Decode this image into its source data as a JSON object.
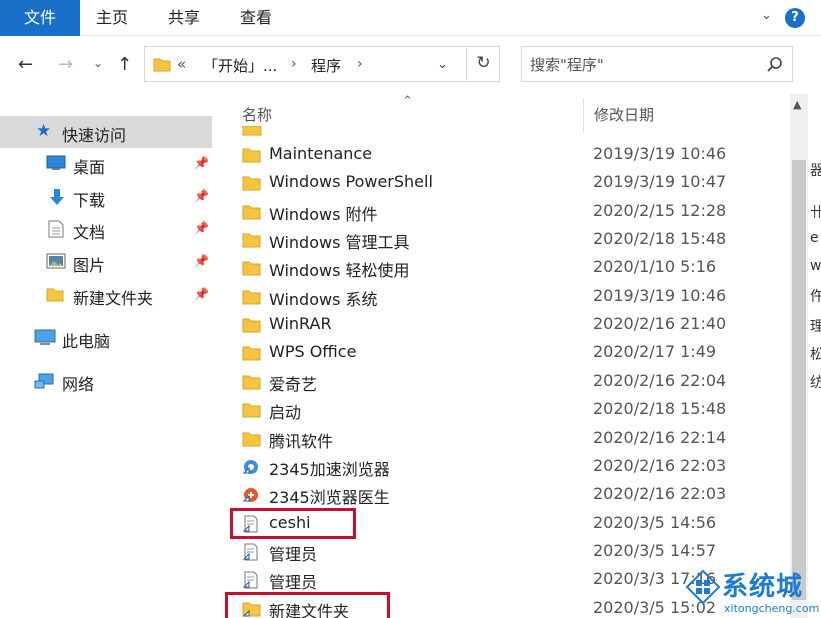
{
  "ribbon": {
    "tabs": [
      "文件",
      "主页",
      "共享",
      "查看"
    ],
    "help_label": "?"
  },
  "address": {
    "segments": [
      "«",
      "「开始」...",
      "程序"
    ],
    "search_placeholder": "搜索\"程序\""
  },
  "nav_pane": {
    "quick_access": "快速访问",
    "pinned": [
      "桌面",
      "下载",
      "文档",
      "图片",
      "新建文件夹"
    ],
    "this_pc": "此电脑",
    "network": "网络"
  },
  "file_list": {
    "columns": {
      "name": "名称",
      "modified": "修改日期"
    },
    "rows": [
      {
        "name": "Maintenance",
        "date": "2019/3/19 10:46",
        "icon": "folder-icon"
      },
      {
        "name": "Windows PowerShell",
        "date": "2019/3/19 10:47",
        "icon": "folder-icon"
      },
      {
        "name": "Windows 附件",
        "date": "2020/2/15 12:28",
        "icon": "folder-icon"
      },
      {
        "name": "Windows 管理工具",
        "date": "2020/2/18 15:48",
        "icon": "folder-icon"
      },
      {
        "name": "Windows 轻松使用",
        "date": "2020/1/10 5:16",
        "icon": "folder-icon"
      },
      {
        "name": "Windows 系统",
        "date": "2019/3/19 10:46",
        "icon": "folder-icon"
      },
      {
        "name": "WinRAR",
        "date": "2020/2/16 21:40",
        "icon": "folder-icon"
      },
      {
        "name": "WPS Office",
        "date": "2020/2/17 1:49",
        "icon": "folder-icon"
      },
      {
        "name": "爱奇艺",
        "date": "2020/2/16 22:04",
        "icon": "folder-icon"
      },
      {
        "name": "启动",
        "date": "2020/2/18 15:48",
        "icon": "folder-icon"
      },
      {
        "name": "腾讯软件",
        "date": "2020/2/16 22:14",
        "icon": "folder-icon"
      },
      {
        "name": "2345加速浏览器",
        "date": "2020/2/16 22:03",
        "icon": "browser-shortcut-icon"
      },
      {
        "name": "2345浏览器医生",
        "date": "2020/2/16 22:03",
        "icon": "browser-doctor-shortcut-icon"
      },
      {
        "name": "ceshi",
        "date": "2020/3/5 14:56",
        "icon": "file-shortcut-icon"
      },
      {
        "name": "管理员",
        "date": "2020/3/5 14:57",
        "icon": "file-shortcut-icon"
      },
      {
        "name": "管理员",
        "date": "2020/3/3 17:16",
        "icon": "file-shortcut-icon"
      },
      {
        "name": "新建文件夹",
        "date": "2020/3/5 15:02",
        "icon": "folder-shortcut-icon"
      }
    ]
  },
  "watermark": {
    "title": "系统城",
    "subtitle": "xitongcheng.com"
  },
  "colors": {
    "accent": "#1a6fc9",
    "selection": "#d9d9d9",
    "folder": "#f5c542",
    "highlight_box": "#c8102e"
  }
}
